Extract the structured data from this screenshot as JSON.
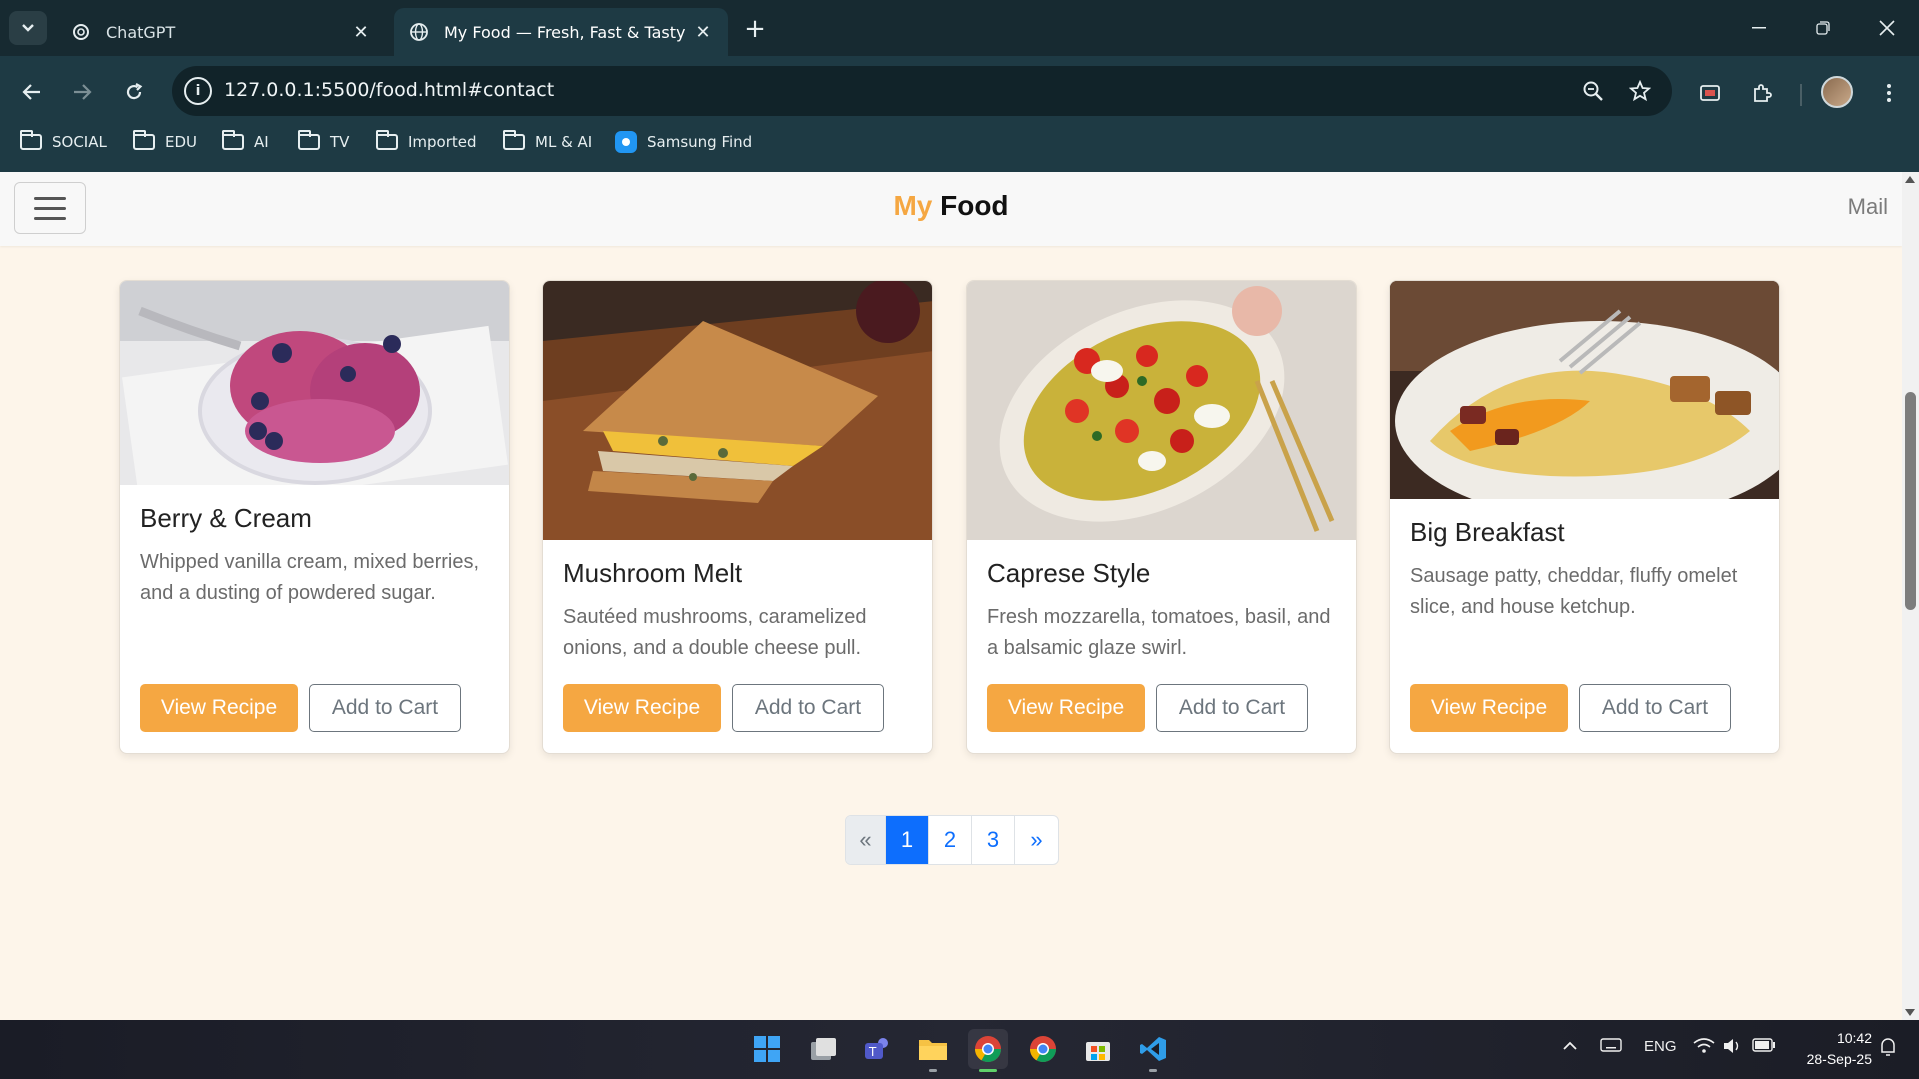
{
  "browser": {
    "tabs": [
      {
        "title": "ChatGPT",
        "active": false
      },
      {
        "title": "My Food — Fresh, Fast & Tasty",
        "active": true
      }
    ],
    "url": "127.0.0.1:5500/food.html#contact",
    "bookmarks": [
      "SOCIAL",
      "EDU",
      "AI",
      "TV",
      "Imported",
      "ML & AI",
      "Samsung Find"
    ]
  },
  "site": {
    "brand_my": "My",
    "brand_food": "Food",
    "mail": "Mail",
    "accent_color": "#f5a742",
    "pagination_active_color": "#0d6efd"
  },
  "cards": [
    {
      "title": "Berry & Cream",
      "desc": "Whipped vanilla cream, mixed berries, and a dusting of powdered sugar.",
      "primary": "View Recipe",
      "secondary": "Add to Cart"
    },
    {
      "title": "Mushroom Melt",
      "desc": "Sautéed mushrooms, caramelized onions, and a double cheese pull.",
      "primary": "View Recipe",
      "secondary": "Add to Cart"
    },
    {
      "title": "Caprese Style",
      "desc": "Fresh mozzarella, tomatoes, basil, and a balsamic glaze swirl.",
      "primary": "View Recipe",
      "secondary": "Add to Cart"
    },
    {
      "title": "Big Breakfast",
      "desc": "Sausage patty, cheddar, fluffy omelet slice, and house ketchup.",
      "primary": "View Recipe",
      "secondary": "Add to Cart"
    }
  ],
  "pagination": {
    "prev": "«",
    "pages": [
      "1",
      "2",
      "3"
    ],
    "next": "»",
    "current": "1"
  },
  "taskbar": {
    "tray_lang": "ENG",
    "time": "10:42",
    "date": "28-Sep-25"
  }
}
